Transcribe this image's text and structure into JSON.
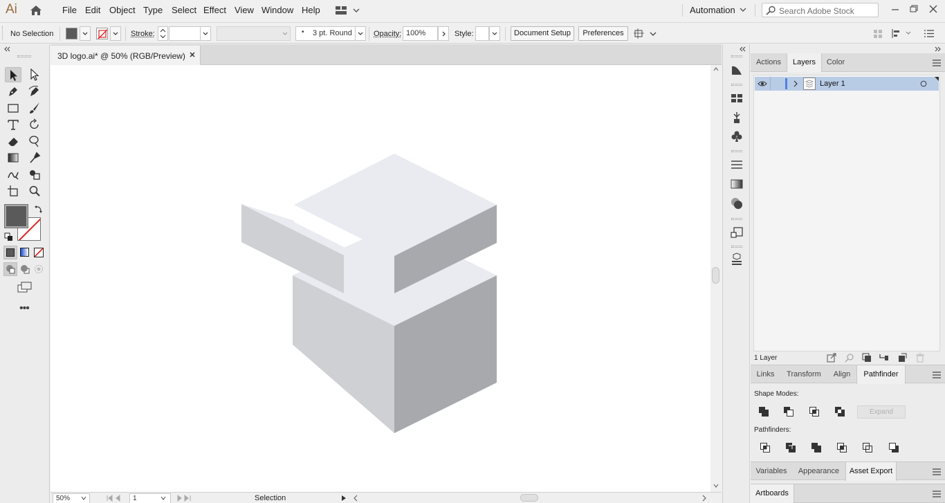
{
  "app": {
    "logo": "Ai",
    "menu": [
      "File",
      "Edit",
      "Object",
      "Type",
      "Select",
      "Effect",
      "View",
      "Window",
      "Help"
    ],
    "workspace": "Automation",
    "search_placeholder": "Search Adobe Stock"
  },
  "control_bar": {
    "selection_status": "No Selection",
    "stroke_label": "Stroke:",
    "brush_profile": "3 pt. Round",
    "opacity_label": "Opacity:",
    "opacity_value": "100%",
    "style_label": "Style:",
    "document_setup": "Document Setup",
    "preferences": "Preferences"
  },
  "document": {
    "tab_title": "3D logo.ai* @ 50% (RGB/Preview)",
    "zoom": "50%",
    "artboard_number": "1",
    "status": "Selection"
  },
  "colors": {
    "fill": "#5a5a5a",
    "stroke": "none",
    "selection_highlight": "#b9cce6",
    "layer_color": "#4f7fe0"
  },
  "panels": {
    "top_tabs": [
      "Actions",
      "Layers",
      "Color"
    ],
    "active_top_tab": "Layers",
    "layers": [
      {
        "name": "Layer 1",
        "visible": true
      }
    ],
    "layer_count": "1 Layer",
    "middle_tabs": [
      "Links",
      "Transform",
      "Align",
      "Pathfinder"
    ],
    "active_middle_tab": "Pathfinder",
    "shape_modes_label": "Shape Modes:",
    "pathfinders_label": "Pathfinders:",
    "expand_label": "Expand",
    "bottom_tabs": [
      "Variables",
      "Appearance",
      "Asset Export"
    ],
    "active_bottom_tab": "Asset Export",
    "last_tab": "Artboards"
  }
}
